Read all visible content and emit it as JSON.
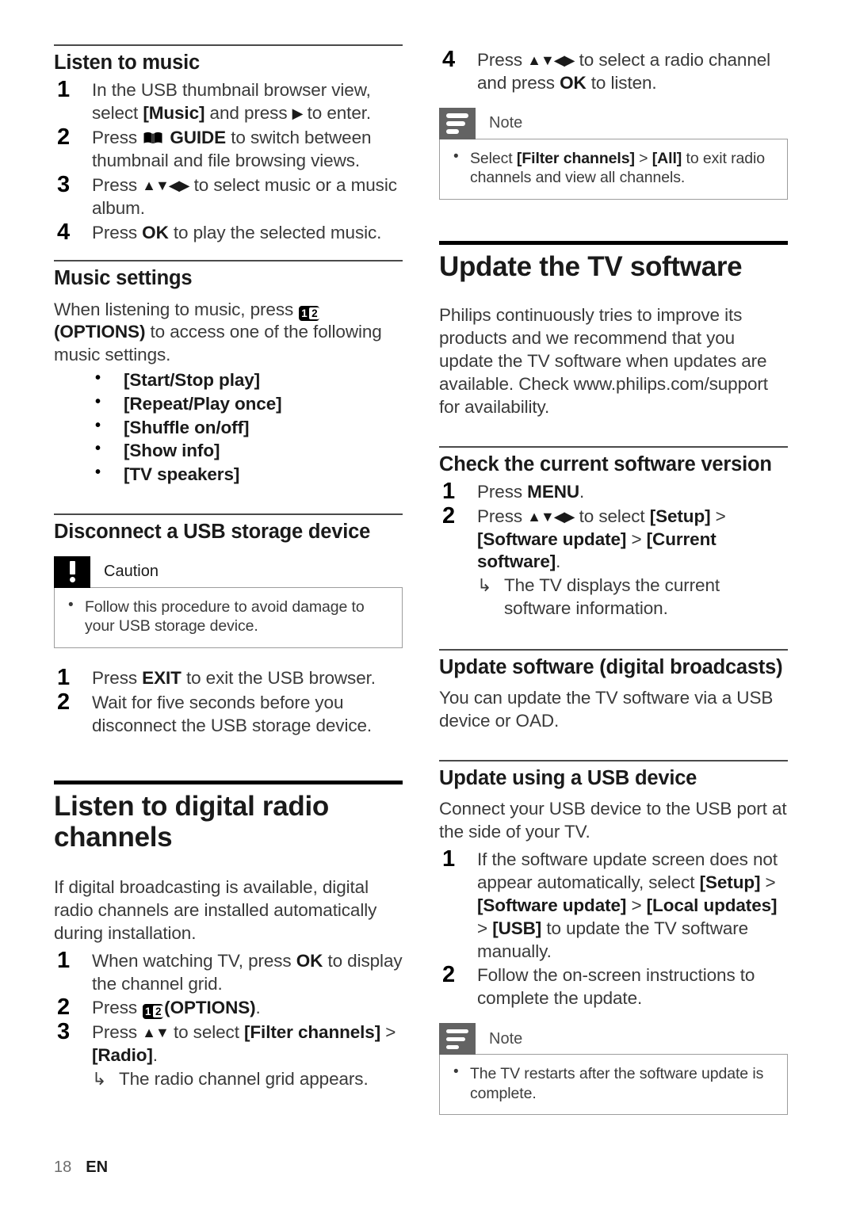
{
  "footer": {
    "page_number": "18",
    "language": "EN"
  },
  "icons": {
    "options": {
      "digit_one": "1",
      "digit_two": "2"
    },
    "options_label": "(OPTIONS)",
    "guide_label": "GUIDE",
    "arrows_updownleftright": "▲▼◀▶",
    "arrows_updown": "▲▼",
    "arrow_right": "▶",
    "substep_arrow": "↳"
  },
  "left_column": {
    "listen_to_music": {
      "heading": "Listen to music",
      "steps": [
        {
          "parts": [
            {
              "t": "In the USB thumbnail browser view, select "
            },
            {
              "t": "[Music]",
              "b": true
            },
            {
              "t": " and press "
            },
            {
              "icon": "arrow_right"
            },
            {
              "t": " to enter."
            }
          ]
        },
        {
          "parts": [
            {
              "t": "Press "
            },
            {
              "icon": "guide"
            },
            {
              "t": " GUIDE",
              "b": true
            },
            {
              "t": " to switch between thumbnail and file browsing views."
            }
          ]
        },
        {
          "parts": [
            {
              "t": "Press "
            },
            {
              "icon": "arrows4"
            },
            {
              "t": " to select music or a music album."
            }
          ]
        },
        {
          "parts": [
            {
              "t": "Press "
            },
            {
              "t": "OK",
              "b": true
            },
            {
              "t": " to play the selected music."
            }
          ]
        }
      ]
    },
    "music_settings": {
      "heading": "Music settings",
      "intro_parts": [
        {
          "t": "When listening to music, press "
        },
        {
          "icon": "options"
        },
        {
          "t": "(OPTIONS)",
          "b": true
        },
        {
          "t": " to access one of the following music settings."
        }
      ],
      "options": [
        "[Start/Stop play]",
        "[Repeat/Play once]",
        "[Shuffle on/off]",
        "[Show info]",
        "[TV speakers]"
      ]
    },
    "disconnect_usb": {
      "heading": "Disconnect a USB storage device",
      "caution": {
        "title": "Caution",
        "items": [
          "Follow this procedure to avoid damage to your USB storage device."
        ]
      },
      "steps": [
        {
          "parts": [
            {
              "t": "Press "
            },
            {
              "t": "EXIT",
              "b": true
            },
            {
              "t": " to exit the USB browser."
            }
          ]
        },
        {
          "parts": [
            {
              "t": "Wait for five seconds before you disconnect the USB storage device."
            }
          ]
        }
      ]
    },
    "digital_radio": {
      "heading": "Listen to digital radio channels",
      "intro": "If digital broadcasting is available, digital radio channels are installed automatically during installation.",
      "steps": [
        {
          "parts": [
            {
              "t": "When watching TV, press "
            },
            {
              "t": "OK",
              "b": true
            },
            {
              "t": " to display the channel grid."
            }
          ]
        },
        {
          "parts": [
            {
              "t": "Press "
            },
            {
              "icon": "options"
            },
            {
              "t": "(OPTIONS)",
              "b": true
            },
            {
              "t": "."
            }
          ]
        },
        {
          "parts": [
            {
              "t": "Press "
            },
            {
              "icon": "arrows2"
            },
            {
              "t": " to select "
            },
            {
              "t": "[Filter channels]",
              "b": true
            },
            {
              "t": " > "
            },
            {
              "t": "[Radio]",
              "b": true
            },
            {
              "t": "."
            }
          ],
          "substep": "The radio channel grid appears."
        }
      ]
    }
  },
  "right_column": {
    "radio_step4": {
      "number": "4",
      "parts": [
        {
          "t": "Press "
        },
        {
          "icon": "arrows4"
        },
        {
          "t": " to select a radio channel and press "
        },
        {
          "t": "OK",
          "b": true
        },
        {
          "t": " to listen."
        }
      ],
      "note": {
        "title": "Note",
        "items_parts": [
          [
            {
              "t": "Select "
            },
            {
              "t": "[Filter channels]",
              "b": true
            },
            {
              "t": " > "
            },
            {
              "t": "[All]",
              "b": true
            },
            {
              "t": " to exit radio channels and view all channels."
            }
          ]
        ]
      }
    },
    "update_tv_software": {
      "heading": "Update the TV software",
      "intro": "Philips continuously tries to improve its products and we recommend that you update the TV software when updates are available. Check www.philips.com/support for availability."
    },
    "check_version": {
      "heading": "Check the current software version",
      "steps": [
        {
          "parts": [
            {
              "t": "Press "
            },
            {
              "t": "MENU",
              "b": true
            },
            {
              "t": "."
            }
          ]
        },
        {
          "parts": [
            {
              "t": "Press "
            },
            {
              "icon": "arrows4"
            },
            {
              "t": " to select "
            },
            {
              "t": "[Setup]",
              "b": true
            },
            {
              "t": " > "
            },
            {
              "t": "[Software update]",
              "b": true
            },
            {
              "t": " > "
            },
            {
              "t": "[Current software]",
              "b": true
            },
            {
              "t": "."
            }
          ],
          "substep": "The TV displays the current software information."
        }
      ]
    },
    "update_digital_broadcasts": {
      "heading": "Update software (digital broadcasts)",
      "intro": "You can update the TV software via a USB device or OAD."
    },
    "update_usb": {
      "heading": "Update using a USB device",
      "intro": "Connect your USB device to the USB port at the side of your TV.",
      "steps": [
        {
          "parts": [
            {
              "t": "If the software update screen does not appear automatically, select "
            },
            {
              "t": "[Setup]",
              "b": true
            },
            {
              "t": " > "
            },
            {
              "t": "[Software update]",
              "b": true
            },
            {
              "t": " > "
            },
            {
              "t": "[Local updates]",
              "b": true
            },
            {
              "t": " > "
            },
            {
              "t": "[USB]",
              "b": true
            },
            {
              "t": " to update the TV software manually."
            }
          ]
        },
        {
          "parts": [
            {
              "t": "Follow the on-screen instructions to complete the update."
            }
          ]
        }
      ],
      "note": {
        "title": "Note",
        "items_parts": [
          [
            {
              "t": "The TV restarts after the software update is complete."
            }
          ]
        ]
      }
    }
  }
}
